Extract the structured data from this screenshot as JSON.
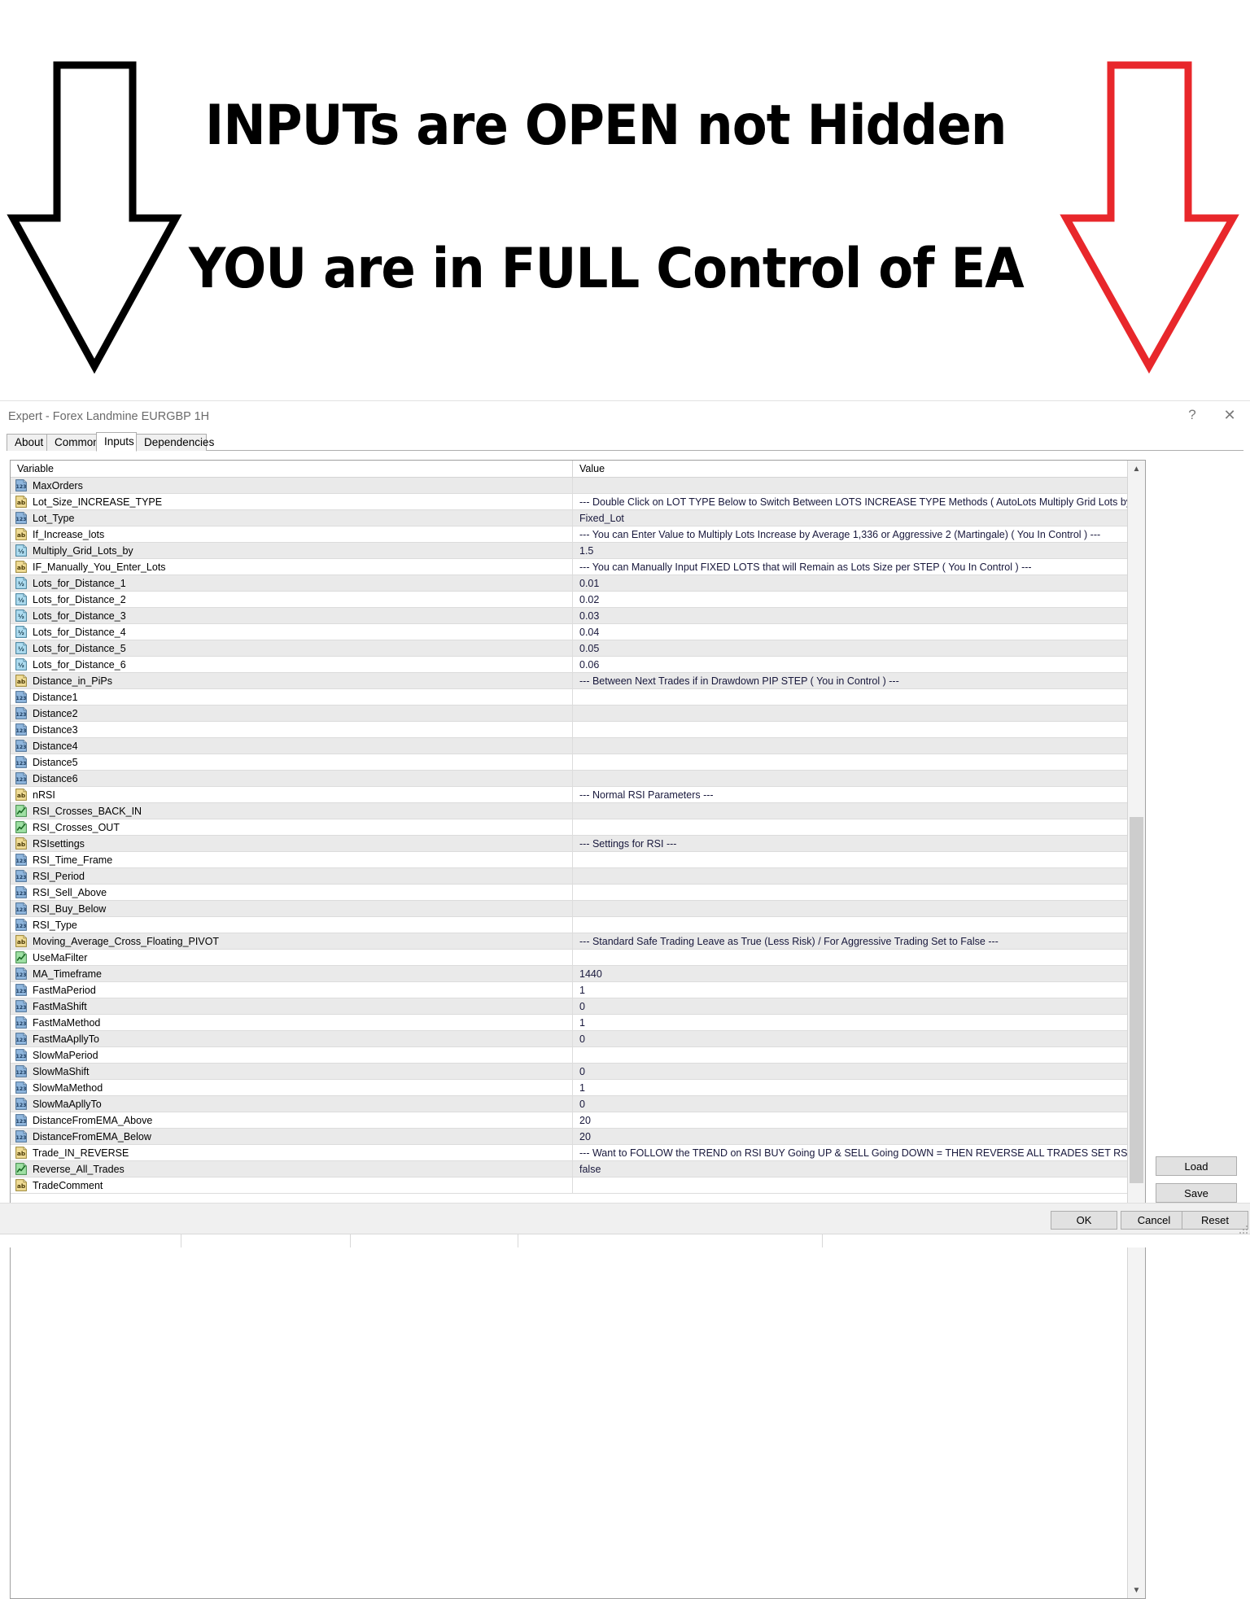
{
  "promo": {
    "line1": "INPUTs are OPEN not Hidden",
    "line2": "YOU are in FULL Control of EA",
    "left_arrow_color": "#000000",
    "right_arrow_color": "#e8272b"
  },
  "dialog": {
    "title": "Expert - Forex Landmine EURGBP 1H",
    "help_label": "?",
    "close_label": "✕"
  },
  "tabs": [
    {
      "label": "About",
      "active": false
    },
    {
      "label": "Common",
      "active": false
    },
    {
      "label": "Inputs",
      "active": true
    },
    {
      "label": "Dependencies",
      "active": false
    }
  ],
  "table": {
    "columns": [
      "Variable",
      "Value"
    ],
    "rows": [
      {
        "icon": "int-icon",
        "variable": "MaxOrders",
        "value": ""
      },
      {
        "icon": "string-icon",
        "variable": "Lot_Size_INCREASE_TYPE",
        "value": "--- Double Click on LOT TYPE Below to Switch Between LOTS INCREASE TYPE Methods ( AutoLots Multiply Grid Lots by X or You Decide L..."
      },
      {
        "icon": "int-icon",
        "variable": "Lot_Type",
        "value": "Fixed_Lot"
      },
      {
        "icon": "string-icon",
        "variable": "If_Increase_lots",
        "value": "--- You can Enter Value to Multiply Lots Increase by Average 1,336 or Aggressive 2 (Martingale) ( You In Control ) ---"
      },
      {
        "icon": "double-icon",
        "variable": "Multiply_Grid_Lots_by",
        "value": "1.5"
      },
      {
        "icon": "string-icon",
        "variable": "IF_Manually_You_Enter_Lots",
        "value": "--- You can Manually Input FIXED LOTS that will Remain as Lots Size per STEP ( You In Control ) ---"
      },
      {
        "icon": "double-icon",
        "variable": "Lots_for_Distance_1",
        "value": "0.01"
      },
      {
        "icon": "double-icon",
        "variable": "Lots_for_Distance_2",
        "value": "0.02"
      },
      {
        "icon": "double-icon",
        "variable": "Lots_for_Distance_3",
        "value": "0.03"
      },
      {
        "icon": "double-icon",
        "variable": "Lots_for_Distance_4",
        "value": "0.04"
      },
      {
        "icon": "double-icon",
        "variable": "Lots_for_Distance_5",
        "value": "0.05"
      },
      {
        "icon": "double-icon",
        "variable": "Lots_for_Distance_6",
        "value": "0.06"
      },
      {
        "icon": "string-icon",
        "variable": "Distance_in_PiPs",
        "value": "--- Between Next Trades if in Drawdown PIP STEP ( You in Control ) ---"
      },
      {
        "icon": "int-icon",
        "variable": "Distance1",
        "value": ""
      },
      {
        "icon": "int-icon",
        "variable": "Distance2",
        "value": ""
      },
      {
        "icon": "int-icon",
        "variable": "Distance3",
        "value": ""
      },
      {
        "icon": "int-icon",
        "variable": "Distance4",
        "value": ""
      },
      {
        "icon": "int-icon",
        "variable": "Distance5",
        "value": ""
      },
      {
        "icon": "int-icon",
        "variable": "Distance6",
        "value": ""
      },
      {
        "icon": "string-icon",
        "variable": "nRSI",
        "value": "--- Normal RSI Parameters ---"
      },
      {
        "icon": "bool-icon",
        "variable": "RSI_Crosses_BACK_IN",
        "value": ""
      },
      {
        "icon": "bool-icon",
        "variable": "RSI_Crosses_OUT",
        "value": ""
      },
      {
        "icon": "string-icon",
        "variable": "RSIsettings",
        "value": "--- Settings for RSI ---"
      },
      {
        "icon": "int-icon",
        "variable": "RSI_Time_Frame",
        "value": ""
      },
      {
        "icon": "int-icon",
        "variable": "RSI_Period",
        "value": ""
      },
      {
        "icon": "int-icon",
        "variable": "RSI_Sell_Above",
        "value": ""
      },
      {
        "icon": "int-icon",
        "variable": "RSI_Buy_Below",
        "value": ""
      },
      {
        "icon": "int-icon",
        "variable": "RSI_Type",
        "value": ""
      },
      {
        "icon": "string-icon",
        "variable": "Moving_Average_Cross_Floating_PIVOT",
        "value": "--- Standard Safe Trading Leave as True (Less Risk) / For Aggressive Trading Set to False ---"
      },
      {
        "icon": "bool-icon",
        "variable": "UseMaFilter",
        "value": ""
      },
      {
        "icon": "int-icon",
        "variable": "MA_Timeframe",
        "value": "1440"
      },
      {
        "icon": "int-icon",
        "variable": "FastMaPeriod",
        "value": "1"
      },
      {
        "icon": "int-icon",
        "variable": "FastMaShift",
        "value": "0"
      },
      {
        "icon": "int-icon",
        "variable": "FastMaMethod",
        "value": "1"
      },
      {
        "icon": "int-icon",
        "variable": "FastMaApllyTo",
        "value": "0"
      },
      {
        "icon": "int-icon",
        "variable": "SlowMaPeriod",
        "value": ""
      },
      {
        "icon": "int-icon",
        "variable": "SlowMaShift",
        "value": "0"
      },
      {
        "icon": "int-icon",
        "variable": "SlowMaMethod",
        "value": "1"
      },
      {
        "icon": "int-icon",
        "variable": "SlowMaApllyTo",
        "value": "0"
      },
      {
        "icon": "int-icon",
        "variable": "DistanceFromEMA_Above",
        "value": "20"
      },
      {
        "icon": "int-icon",
        "variable": "DistanceFromEMA_Below",
        "value": "20"
      },
      {
        "icon": "string-icon",
        "variable": "Trade_IN_REVERSE",
        "value": "--- Want to FOLLOW the TREND on RSI BUY Going UP & SELL Going DOWN = THEN REVERSE ALL TRADES SET RSI PERIOD & Level..."
      },
      {
        "icon": "bool-icon",
        "variable": "Reverse_All_Trades",
        "value": "false"
      },
      {
        "icon": "string-icon",
        "variable": "TradeComment",
        "value": ""
      }
    ]
  },
  "side_buttons": {
    "load": "Load",
    "save": "Save"
  },
  "footer_buttons": {
    "ok": "OK",
    "cancel": "Cancel",
    "reset": "Reset"
  },
  "scrollbar": {
    "up": "▲",
    "down": "▼"
  }
}
